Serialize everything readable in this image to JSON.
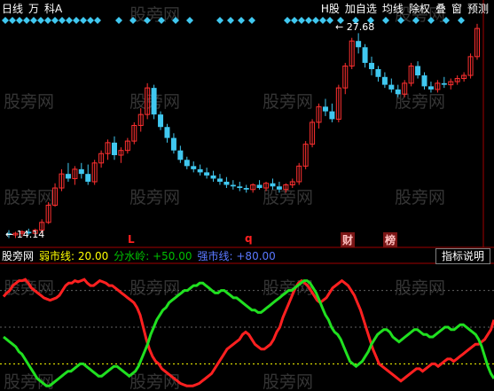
{
  "toolbar": {
    "left": [
      "日线",
      "万",
      "科A"
    ],
    "right": [
      "H股",
      "加自选",
      "均线",
      "除权",
      "叠",
      "窗",
      "预测"
    ]
  },
  "prices": {
    "high_label": "27.68",
    "low_label": "14.14"
  },
  "markers": {
    "l": "L",
    "q": "q",
    "cai": "财",
    "bang": "榜"
  },
  "indicator": {
    "name": "股旁网",
    "weak": "弱市线: 20.00",
    "water": "分水岭: +50.00",
    "strong": "强市线: +80.00",
    "desc_button": "指标说明"
  },
  "watermark": "股旁网",
  "colors": {
    "up": "#ff3030",
    "down": "#40c8f0",
    "green": "#20e020",
    "red": "#ff2020",
    "diamond": "#40c8f0"
  },
  "candles": [
    [
      14.3,
      14.5,
      14.0,
      14.2
    ],
    [
      14.2,
      14.4,
      14.0,
      14.3
    ],
    [
      14.3,
      14.5,
      14.1,
      14.4
    ],
    [
      14.4,
      14.6,
      14.2,
      14.3
    ],
    [
      14.3,
      14.6,
      14.1,
      14.5
    ],
    [
      14.5,
      15.2,
      14.3,
      15.0
    ],
    [
      15.0,
      16.3,
      14.9,
      16.1
    ],
    [
      16.1,
      17.5,
      16.0,
      17.2
    ],
    [
      17.2,
      18.4,
      17.0,
      18.1
    ],
    [
      18.1,
      18.8,
      17.6,
      17.8
    ],
    [
      17.8,
      18.6,
      17.4,
      18.4
    ],
    [
      18.4,
      18.8,
      17.8,
      18.1
    ],
    [
      18.1,
      18.7,
      17.4,
      17.6
    ],
    [
      17.6,
      19.0,
      17.4,
      18.8
    ],
    [
      18.8,
      19.6,
      18.5,
      19.4
    ],
    [
      19.4,
      20.3,
      19.0,
      20.1
    ],
    [
      20.1,
      20.5,
      19.0,
      19.3
    ],
    [
      19.3,
      19.8,
      18.8,
      19.6
    ],
    [
      19.6,
      20.4,
      19.4,
      20.2
    ],
    [
      20.2,
      21.4,
      20.0,
      21.2
    ],
    [
      21.2,
      22.3,
      20.8,
      21.9
    ],
    [
      21.9,
      23.9,
      21.6,
      23.6
    ],
    [
      23.6,
      23.8,
      21.6,
      21.9
    ],
    [
      21.9,
      22.1,
      20.9,
      21.1
    ],
    [
      21.1,
      21.3,
      20.1,
      20.4
    ],
    [
      20.4,
      20.7,
      19.4,
      19.6
    ],
    [
      19.6,
      19.9,
      18.8,
      19.0
    ],
    [
      19.0,
      19.2,
      18.4,
      18.6
    ],
    [
      18.6,
      18.9,
      18.2,
      18.4
    ],
    [
      18.4,
      18.7,
      18.0,
      18.2
    ],
    [
      18.2,
      18.5,
      17.8,
      18.0
    ],
    [
      18.0,
      18.3,
      17.6,
      17.8
    ],
    [
      17.8,
      18.1,
      17.4,
      17.6
    ],
    [
      17.6,
      17.9,
      17.2,
      17.4
    ],
    [
      17.4,
      17.7,
      17.1,
      17.3
    ],
    [
      17.3,
      17.6,
      17.0,
      17.2
    ],
    [
      17.2,
      17.4,
      16.9,
      17.1
    ],
    [
      17.1,
      17.5,
      16.9,
      17.4
    ],
    [
      17.4,
      17.7,
      17.1,
      17.2
    ],
    [
      17.2,
      17.6,
      17.0,
      17.5
    ],
    [
      17.5,
      17.8,
      17.1,
      17.3
    ],
    [
      17.3,
      17.6,
      16.9,
      17.1
    ],
    [
      17.1,
      17.5,
      16.9,
      17.4
    ],
    [
      17.4,
      17.8,
      17.2,
      17.6
    ],
    [
      17.6,
      18.8,
      17.4,
      18.6
    ],
    [
      18.6,
      20.2,
      18.4,
      20.0
    ],
    [
      20.0,
      21.6,
      19.8,
      21.4
    ],
    [
      21.4,
      22.6,
      21.0,
      22.4
    ],
    [
      22.4,
      22.9,
      21.8,
      22.1
    ],
    [
      22.1,
      22.6,
      21.4,
      21.6
    ],
    [
      21.6,
      23.8,
      21.4,
      23.6
    ],
    [
      23.6,
      25.2,
      23.2,
      25.0
    ],
    [
      25.0,
      26.8,
      24.8,
      26.6
    ],
    [
      26.6,
      27.1,
      25.8,
      26.2
    ],
    [
      26.2,
      26.4,
      24.9,
      25.2
    ],
    [
      25.2,
      25.6,
      24.4,
      24.8
    ],
    [
      24.8,
      25.0,
      24.0,
      24.3
    ],
    [
      24.3,
      24.6,
      23.6,
      23.8
    ],
    [
      23.8,
      24.2,
      23.3,
      23.5
    ],
    [
      23.5,
      23.8,
      23.0,
      23.2
    ],
    [
      23.2,
      24.1,
      23.0,
      23.9
    ],
    [
      23.9,
      25.2,
      23.7,
      25.0
    ],
    [
      25.0,
      25.3,
      24.2,
      24.4
    ],
    [
      24.4,
      24.6,
      23.5,
      23.7
    ],
    [
      23.7,
      24.0,
      23.3,
      23.5
    ],
    [
      23.5,
      24.1,
      23.3,
      23.9
    ],
    [
      23.9,
      24.3,
      23.6,
      23.8
    ],
    [
      23.8,
      24.2,
      23.5,
      24.0
    ],
    [
      24.0,
      24.4,
      23.8,
      24.2
    ],
    [
      24.2,
      24.6,
      24.0,
      24.4
    ],
    [
      24.4,
      25.8,
      24.2,
      25.6
    ],
    [
      25.6,
      27.7,
      25.4,
      27.4
    ]
  ],
  "red_line": [
    75,
    78,
    80,
    84,
    86,
    88,
    88,
    89,
    86,
    82,
    80,
    78,
    76,
    74,
    73,
    72,
    73,
    74,
    76,
    80,
    84,
    86,
    86,
    88,
    87,
    88,
    89,
    86,
    84,
    84,
    86,
    88,
    87,
    86,
    84,
    84,
    82,
    80,
    78,
    76,
    74,
    72,
    70,
    66,
    60,
    50,
    40,
    32,
    26,
    22,
    20,
    16,
    14,
    12,
    10,
    8,
    6,
    4,
    3,
    2,
    2,
    2,
    3,
    4,
    6,
    8,
    10,
    12,
    16,
    20,
    24,
    28,
    32,
    34,
    36,
    38,
    40,
    44,
    46,
    44,
    40,
    36,
    34,
    32,
    32,
    34,
    36,
    40,
    46,
    50,
    58,
    64,
    70,
    76,
    82,
    86,
    88,
    86,
    84,
    80,
    76,
    72,
    70,
    72,
    74,
    78,
    82,
    84,
    86,
    88,
    86,
    84,
    80,
    76,
    70,
    64,
    56,
    48,
    40,
    32,
    26,
    20,
    18,
    16,
    14,
    12,
    10,
    8,
    6,
    8,
    10,
    12,
    14,
    16,
    16,
    14,
    16,
    18,
    20,
    20,
    18,
    20,
    22,
    24,
    24,
    22,
    24,
    26,
    28,
    30,
    32,
    34,
    36,
    36,
    38,
    40,
    44,
    48,
    56
  ],
  "green_line": [
    42,
    40,
    38,
    36,
    34,
    30,
    28,
    24,
    20,
    16,
    12,
    8,
    6,
    4,
    2,
    2,
    4,
    6,
    8,
    10,
    12,
    14,
    14,
    16,
    18,
    20,
    20,
    18,
    16,
    14,
    12,
    10,
    10,
    12,
    14,
    16,
    18,
    18,
    16,
    14,
    12,
    10,
    12,
    14,
    18,
    24,
    30,
    36,
    44,
    50,
    56,
    60,
    64,
    66,
    70,
    72,
    74,
    76,
    78,
    80,
    80,
    82,
    84,
    84,
    86,
    86,
    84,
    82,
    80,
    78,
    78,
    80,
    80,
    78,
    76,
    74,
    74,
    72,
    70,
    68,
    66,
    64,
    64,
    62,
    62,
    64,
    66,
    68,
    70,
    72,
    74,
    76,
    78,
    80,
    80,
    82,
    84,
    86,
    88,
    88,
    86,
    82,
    78,
    72,
    66,
    60,
    56,
    50,
    46,
    44,
    40,
    34,
    28,
    22,
    20,
    18,
    20,
    22,
    26,
    30,
    36,
    40,
    44,
    46,
    48,
    48,
    46,
    42,
    40,
    38,
    40,
    42,
    44,
    46,
    48,
    48,
    46,
    44,
    44,
    42,
    42,
    44,
    46,
    48,
    50,
    50,
    48,
    48,
    50,
    52,
    52,
    50,
    48,
    46,
    44,
    40,
    34,
    26,
    18,
    12,
    8
  ]
}
